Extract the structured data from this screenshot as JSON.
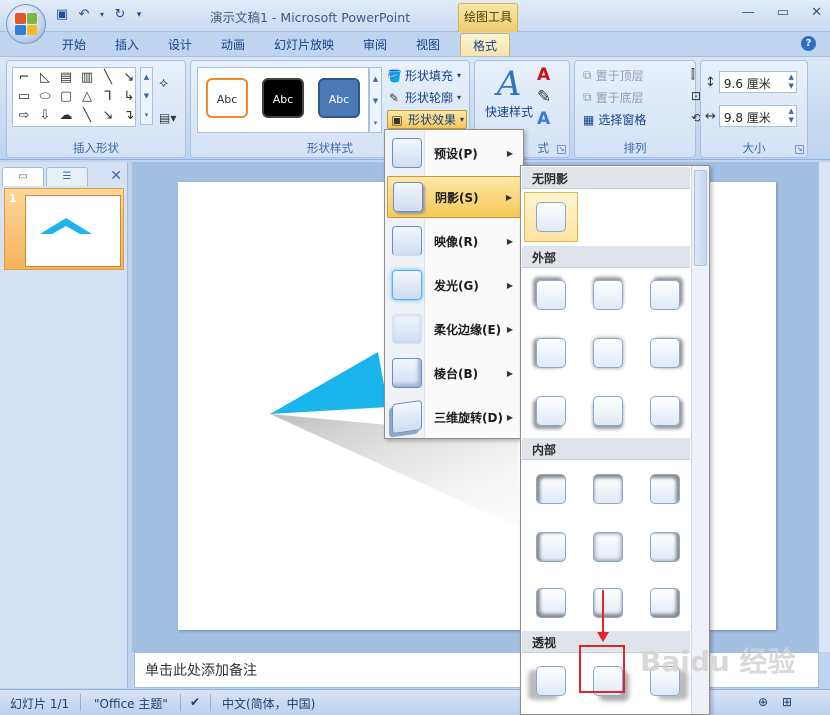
{
  "titlebar": {
    "title": "演示文稿1 - Microsoft PowerPoint",
    "context_tool": "绘图工具"
  },
  "tabs": [
    {
      "label": "开始"
    },
    {
      "label": "插入"
    },
    {
      "label": "设计"
    },
    {
      "label": "动画"
    },
    {
      "label": "幻灯片放映"
    },
    {
      "label": "审阅"
    },
    {
      "label": "视图"
    },
    {
      "label": "格式"
    }
  ],
  "ribbon": {
    "insert_shapes_label": "插入形状",
    "shape_styles_label": "形状样式",
    "style_swatch_text": "Abc",
    "fill_label": "形状填充",
    "outline_label": "形状轮廓",
    "effects_label": "形状效果",
    "quick_styles_label": "快速样式",
    "wordart_partial_label": "式",
    "bring_front_label": "置于顶层",
    "send_back_label": "置于底层",
    "selection_pane_label": "选择窗格",
    "arrange_label": "排列",
    "size_label": "大小",
    "height_value": "9.6 厘米",
    "width_value": "9.8 厘米"
  },
  "effects_menu": {
    "items": [
      {
        "label": "预设(P)",
        "active": false
      },
      {
        "label": "阴影(S)",
        "active": true
      },
      {
        "label": "映像(R)",
        "active": false
      },
      {
        "label": "发光(G)",
        "active": false
      },
      {
        "label": "柔化边缘(E)",
        "active": false
      },
      {
        "label": "棱台(B)",
        "active": false
      },
      {
        "label": "三维旋转(D)",
        "active": false
      }
    ]
  },
  "shadow_gallery": {
    "no_shadow_label": "无阴影",
    "outer_label": "外部",
    "inner_label": "内部",
    "perspective_label": "透视"
  },
  "left_panel": {
    "slide_number": "1"
  },
  "notes": {
    "placeholder": "单击此处添加备注"
  },
  "statusbar": {
    "slide_info": "幻灯片 1/1",
    "theme": "\"Office 主题\"",
    "language": "中文(简体，中国)"
  },
  "watermark": "Baidu 经验",
  "colors": {
    "accent_orange": "#f6b25c",
    "shape_fill": "#1ab5ec",
    "highlight_red": "#e0262a"
  }
}
